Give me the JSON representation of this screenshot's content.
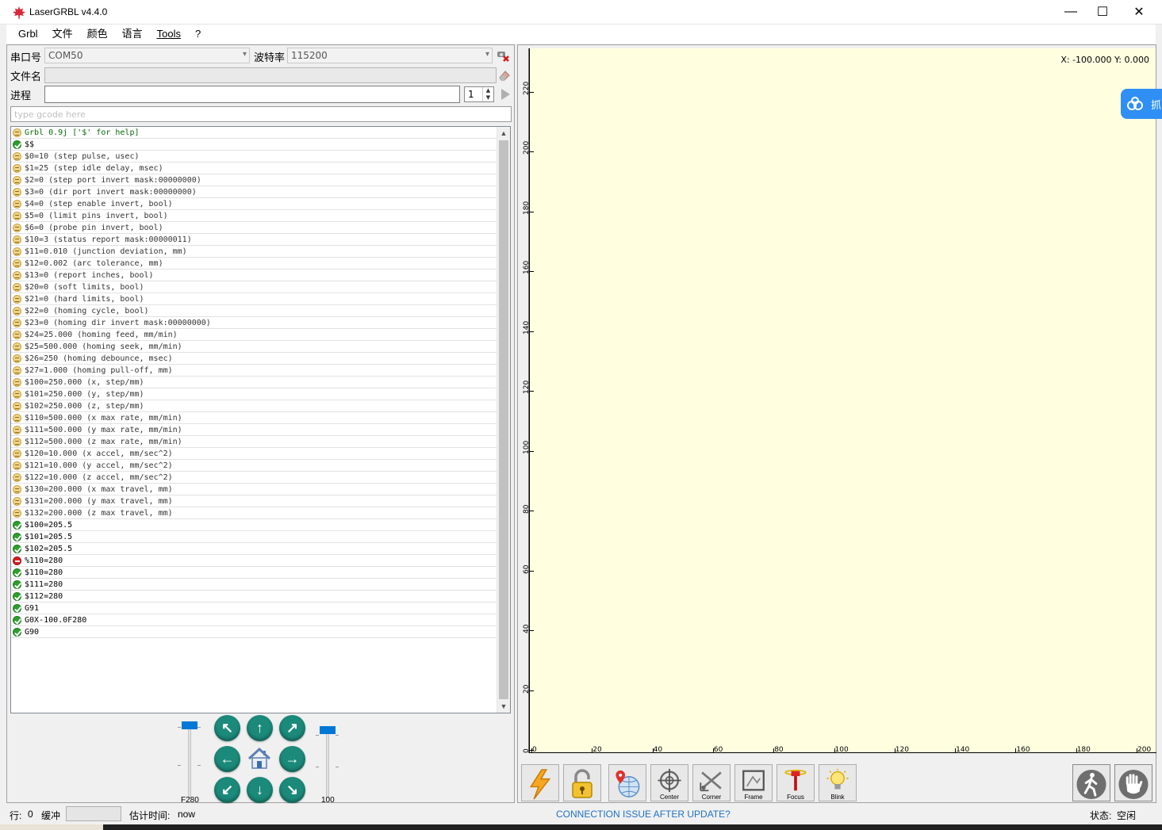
{
  "window": {
    "title": "LaserGRBL v4.4.0",
    "minimize": "—",
    "maximize": "☐",
    "close": "✕"
  },
  "menu": {
    "items": [
      "Grbl",
      "文件",
      "颜色",
      "语言",
      "Tools",
      "?"
    ]
  },
  "connection": {
    "port_label": "串口号",
    "port_value": "COM50",
    "baud_label": "波特率",
    "baud_value": "115200",
    "file_label": "文件名",
    "file_value": "",
    "progress_label": "进程",
    "progress_value": 0,
    "passes_value": "1",
    "gcode_placeholder": "type gcode here"
  },
  "console": {
    "rows": [
      {
        "type": "info",
        "text": "Grbl 0.9j ['$' for help]",
        "style": "green"
      },
      {
        "type": "ok",
        "text": "$$",
        "style": "dark"
      },
      {
        "type": "info",
        "text": "$0=10 (step pulse, usec)"
      },
      {
        "type": "info",
        "text": "$1=25 (step idle delay, msec)"
      },
      {
        "type": "info",
        "text": "$2=0 (step port invert mask:00000000)"
      },
      {
        "type": "info",
        "text": "$3=0 (dir port invert mask:00000000)"
      },
      {
        "type": "info",
        "text": "$4=0 (step enable invert, bool)"
      },
      {
        "type": "info",
        "text": "$5=0 (limit pins invert, bool)"
      },
      {
        "type": "info",
        "text": "$6=0 (probe pin invert, bool)"
      },
      {
        "type": "info",
        "text": "$10=3 (status report mask:00000011)"
      },
      {
        "type": "info",
        "text": "$11=0.010 (junction deviation, mm)"
      },
      {
        "type": "info",
        "text": "$12=0.002 (arc tolerance, mm)"
      },
      {
        "type": "info",
        "text": "$13=0 (report inches, bool)"
      },
      {
        "type": "info",
        "text": "$20=0 (soft limits, bool)"
      },
      {
        "type": "info",
        "text": "$21=0 (hard limits, bool)"
      },
      {
        "type": "info",
        "text": "$22=0 (homing cycle, bool)"
      },
      {
        "type": "info",
        "text": "$23=0 (homing dir invert mask:00000000)"
      },
      {
        "type": "info",
        "text": "$24=25.000 (homing feed, mm/min)"
      },
      {
        "type": "info",
        "text": "$25=500.000 (homing seek, mm/min)"
      },
      {
        "type": "info",
        "text": "$26=250 (homing debounce, msec)"
      },
      {
        "type": "info",
        "text": "$27=1.000 (homing pull-off, mm)"
      },
      {
        "type": "info",
        "text": "$100=250.000 (x, step/mm)"
      },
      {
        "type": "info",
        "text": "$101=250.000 (y, step/mm)"
      },
      {
        "type": "info",
        "text": "$102=250.000 (z, step/mm)"
      },
      {
        "type": "info",
        "text": "$110=500.000 (x max rate, mm/min)"
      },
      {
        "type": "info",
        "text": "$111=500.000 (y max rate, mm/min)"
      },
      {
        "type": "info",
        "text": "$112=500.000 (z max rate, mm/min)"
      },
      {
        "type": "info",
        "text": "$120=10.000 (x accel, mm/sec^2)"
      },
      {
        "type": "info",
        "text": "$121=10.000 (y accel, mm/sec^2)"
      },
      {
        "type": "info",
        "text": "$122=10.000 (z accel, mm/sec^2)"
      },
      {
        "type": "info",
        "text": "$130=200.000 (x max travel, mm)"
      },
      {
        "type": "info",
        "text": "$131=200.000 (y max travel, mm)"
      },
      {
        "type": "info",
        "text": "$132=200.000 (z max travel, mm)"
      },
      {
        "type": "ok",
        "text": "$100=205.5",
        "style": "dark"
      },
      {
        "type": "ok",
        "text": "$101=205.5",
        "style": "dark"
      },
      {
        "type": "ok",
        "text": "$102=205.5",
        "style": "dark"
      },
      {
        "type": "err",
        "text": "%110=280",
        "style": "dark"
      },
      {
        "type": "ok",
        "text": "$110=280",
        "style": "dark"
      },
      {
        "type": "ok",
        "text": "$111=280",
        "style": "dark"
      },
      {
        "type": "ok",
        "text": "$112=280",
        "style": "dark"
      },
      {
        "type": "ok",
        "text": "G91",
        "style": "dark"
      },
      {
        "type": "ok",
        "text": "G0X-100.0F280",
        "style": "dark"
      },
      {
        "type": "ok",
        "text": "G90",
        "style": "dark"
      }
    ]
  },
  "jog": {
    "speed_label": "F280",
    "step_label": "100",
    "speed_level": 1.0,
    "step_level": 0.92
  },
  "preview": {
    "coord_text": "X: -100.000 Y: 0.000",
    "y_ticks": [
      "0",
      "20",
      "40",
      "60",
      "80",
      "100",
      "120",
      "140",
      "160",
      "180",
      "200",
      "220"
    ],
    "x_ticks": [
      "0",
      "20",
      "40",
      "60",
      "80",
      "100",
      "120",
      "140",
      "160",
      "180",
      "200"
    ],
    "canvas_color": "#ffffe0"
  },
  "toolbar": {
    "buttons": [
      "",
      "",
      "",
      "Center",
      "Corner",
      "Frame",
      "Focus",
      "Blink"
    ]
  },
  "status": {
    "line_label": "行:",
    "line_value": "0",
    "buffer_label": "缓冲",
    "eta_label": "估计时间:",
    "eta_value": "now",
    "link_text": "CONNECTION ISSUE AFTER UPDATE?",
    "state_label": "状态:",
    "state_value": "空闲"
  },
  "side_badge": {
    "text": "抓"
  },
  "colors": {
    "accent": "#0078d7",
    "jog": "#1b8a7a",
    "link": "#1e72c4",
    "ok": "#2ca02c",
    "error": "#d62020"
  }
}
